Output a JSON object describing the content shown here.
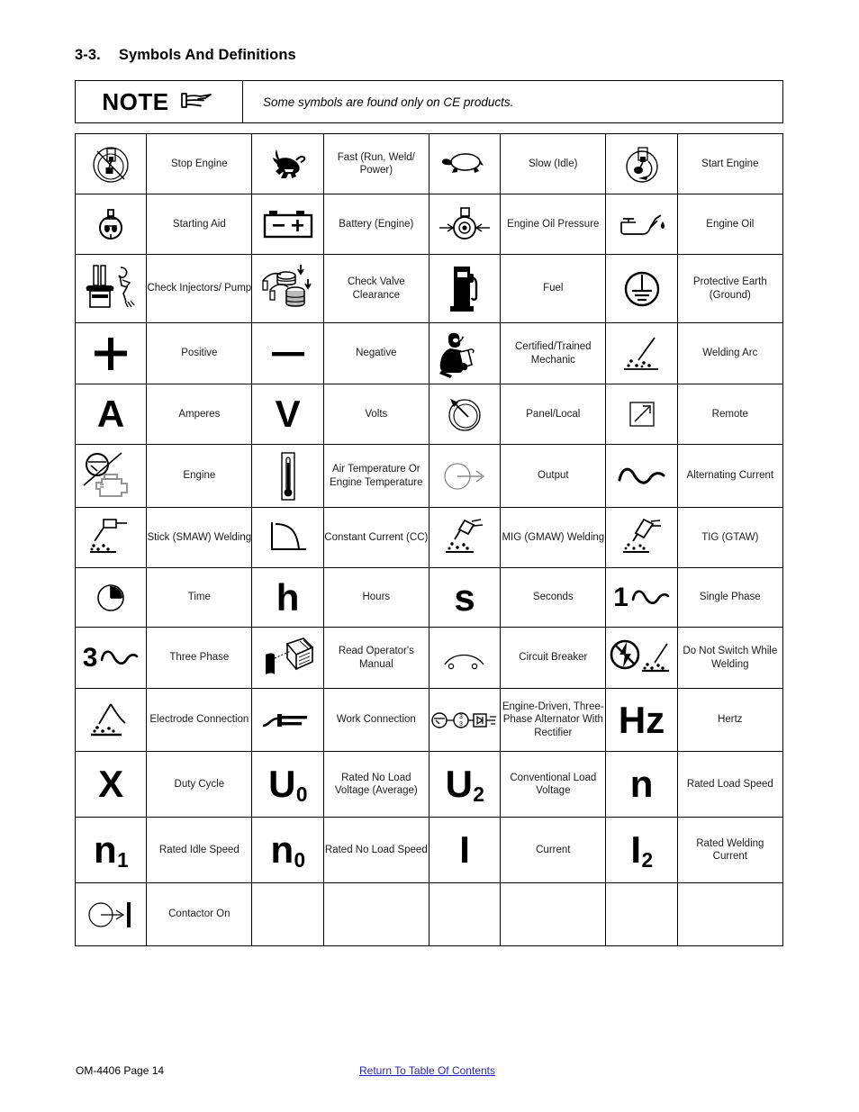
{
  "heading": {
    "number": "3-3.",
    "title": "Symbols And Definitions"
  },
  "note": {
    "word": "NOTE",
    "icon": "pointing-hand-icon",
    "text": "Some symbols are found only on CE products."
  },
  "table": {
    "rows": [
      [
        {
          "icon": "stop-engine-icon",
          "label": "Stop Engine"
        },
        {
          "icon": "rabbit-fast-icon",
          "label": "Fast (Run, Weld/ Power)"
        },
        {
          "icon": "turtle-slow-icon",
          "label": "Slow (Idle)"
        },
        {
          "icon": "start-engine-icon",
          "label": "Start Engine"
        }
      ],
      [
        {
          "icon": "starting-aid-icon",
          "label": "Starting Aid"
        },
        {
          "icon": "battery-icon",
          "label": "Battery (Engine)"
        },
        {
          "icon": "engine-oil-pressure-icon",
          "label": "Engine Oil Pressure"
        },
        {
          "icon": "engine-oil-can-icon",
          "label": "Engine Oil"
        }
      ],
      [
        {
          "icon": "check-injectors-pump-icon",
          "label": "Check Injectors/ Pump"
        },
        {
          "icon": "check-valve-clearance-icon",
          "label": "Check Valve Clearance"
        },
        {
          "icon": "fuel-pump-icon",
          "label": "Fuel"
        },
        {
          "icon": "protective-earth-ground-icon",
          "label": "Protective Earth (Ground)"
        }
      ],
      [
        {
          "icon": "plus-positive-icon",
          "label": "Positive"
        },
        {
          "icon": "minus-negative-icon",
          "label": "Negative"
        },
        {
          "icon": "certified-mechanic-icon",
          "label": "Certified/Trained Mechanic"
        },
        {
          "icon": "welding-arc-icon",
          "label": "Welding Arc"
        }
      ],
      [
        {
          "icon": "letter-a-icon",
          "label": "Amperes"
        },
        {
          "icon": "letter-v-icon",
          "label": "Volts"
        },
        {
          "icon": "panel-local-dial-icon",
          "label": "Panel/Local"
        },
        {
          "icon": "remote-arrow-icon",
          "label": "Remote"
        }
      ],
      [
        {
          "icon": "engine-icon",
          "label": "Engine"
        },
        {
          "icon": "thermometer-icon",
          "label": "Air Temperature Or Engine Temperature"
        },
        {
          "icon": "output-circle-arrow-icon",
          "label": "Output"
        },
        {
          "icon": "alternating-current-sine-icon",
          "label": "Alternating Current"
        }
      ],
      [
        {
          "icon": "stick-smaw-welding-icon",
          "label": "Stick (SMAW) Welding"
        },
        {
          "icon": "constant-current-curve-icon",
          "label": "Constant Current (CC)"
        },
        {
          "icon": "mig-gmaw-welding-icon",
          "label": "MIG (GMAW) Welding"
        },
        {
          "icon": "tig-gtaw-welding-icon",
          "label": "TIG (GTAW)"
        }
      ],
      [
        {
          "icon": "clock-time-icon",
          "label": "Time"
        },
        {
          "icon": "letter-h-icon",
          "label": "Hours"
        },
        {
          "icon": "letter-s-icon",
          "label": "Seconds"
        },
        {
          "icon": "single-phase-icon",
          "label": "Single Phase"
        }
      ],
      [
        {
          "icon": "three-phase-icon",
          "label": "Three Phase"
        },
        {
          "icon": "read-operators-manual-icon",
          "label": "Read Operator's Manual"
        },
        {
          "icon": "circuit-breaker-icon",
          "label": "Circuit Breaker"
        },
        {
          "icon": "do-not-switch-while-welding-icon",
          "label": "Do Not Switch While Welding"
        }
      ],
      [
        {
          "icon": "electrode-connection-icon",
          "label": "Electrode Connection"
        },
        {
          "icon": "work-connection-icon",
          "label": "Work Connection"
        },
        {
          "icon": "engine-driven-alternator-rectifier-icon",
          "label": "Engine-Driven, Three-Phase Alternator With Rectifier"
        },
        {
          "icon": "hertz-icon",
          "label": "Hertz"
        }
      ],
      [
        {
          "icon": "letter-x-icon",
          "label": "Duty Cycle"
        },
        {
          "icon": "u-zero-icon",
          "label": "Rated No Load Voltage (Average)"
        },
        {
          "icon": "u-two-icon",
          "label": "Conventional Load Voltage"
        },
        {
          "icon": "letter-n-icon",
          "label": "Rated Load Speed"
        }
      ],
      [
        {
          "icon": "n-one-icon",
          "label": "Rated Idle Speed"
        },
        {
          "icon": "n-zero-icon",
          "label": "Rated No Load Speed"
        },
        {
          "icon": "letter-i-icon",
          "label": "Current"
        },
        {
          "icon": "i-two-icon",
          "label": "Rated Welding Current"
        }
      ],
      [
        {
          "icon": "contactor-on-icon",
          "label": "Contactor On"
        },
        {
          "icon": "",
          "label": ""
        },
        {
          "icon": "",
          "label": ""
        },
        {
          "icon": "",
          "label": ""
        }
      ]
    ],
    "glyphs": {
      "amperes": "A",
      "volts": "V",
      "hours": "h",
      "seconds": "s",
      "hertz": "Hz",
      "duty_cycle": "X",
      "rated_load_speed": "n",
      "current": "I",
      "u_base": "U",
      "n_base": "n",
      "i_base": "I",
      "sub_zero": "0",
      "sub_one": "1",
      "sub_two": "2",
      "single_phase_digit": "1",
      "three_phase_digit": "3"
    }
  },
  "footer": {
    "page_id": "OM-4406 Page 14",
    "link": "Return To Table Of Contents",
    "link_color": "#2222dd"
  }
}
